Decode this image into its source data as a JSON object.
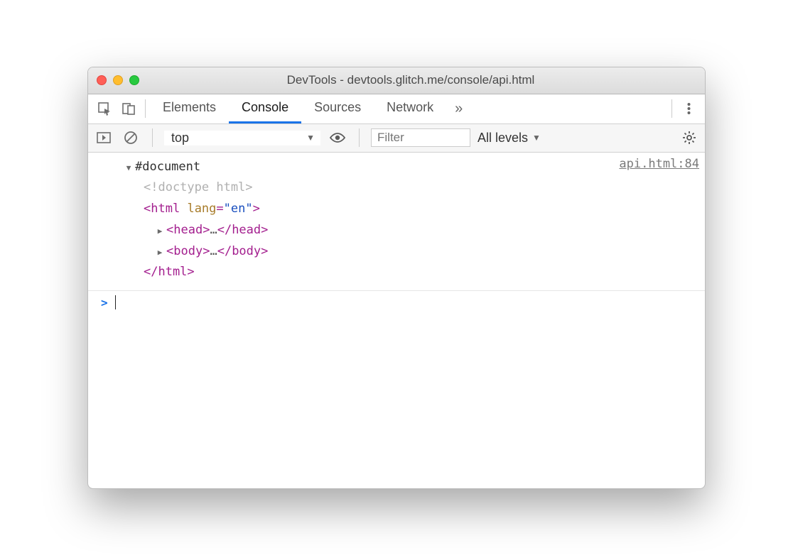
{
  "window": {
    "title": "DevTools - devtools.glitch.me/console/api.html"
  },
  "tabs": {
    "items": [
      "Elements",
      "Console",
      "Sources",
      "Network"
    ],
    "active_index": 1,
    "overflow_glyph": "»"
  },
  "toolbar": {
    "context_label": "top",
    "filter_placeholder": "Filter",
    "levels_label": "All levels"
  },
  "log": {
    "source_link": "api.html:84",
    "root_label": "#document",
    "doctype_text": "<!doctype html>",
    "html_open_tag": "html",
    "html_attr_name": "lang",
    "html_attr_value": "\"en\"",
    "head_tag": "head",
    "body_tag": "body",
    "ellipsis": "…",
    "close_html": "</html>"
  },
  "prompt": {
    "caret": ">"
  }
}
